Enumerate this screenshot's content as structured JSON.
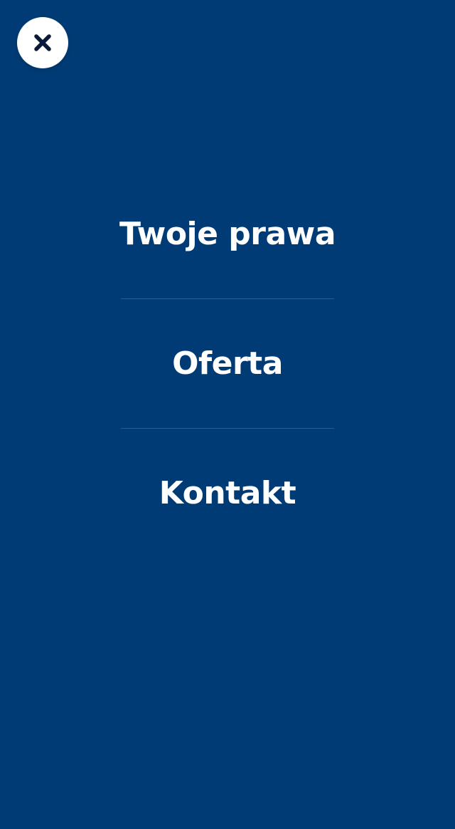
{
  "colors": {
    "background": "#003b75",
    "text": "#ffffff",
    "close_button_bg": "#ffffff",
    "close_icon": "#0a1a3a"
  },
  "close_button": {
    "icon": "close-icon"
  },
  "menu": {
    "items": [
      {
        "label": "Twoje prawa"
      },
      {
        "label": "Oferta"
      },
      {
        "label": "Kontakt"
      }
    ]
  }
}
